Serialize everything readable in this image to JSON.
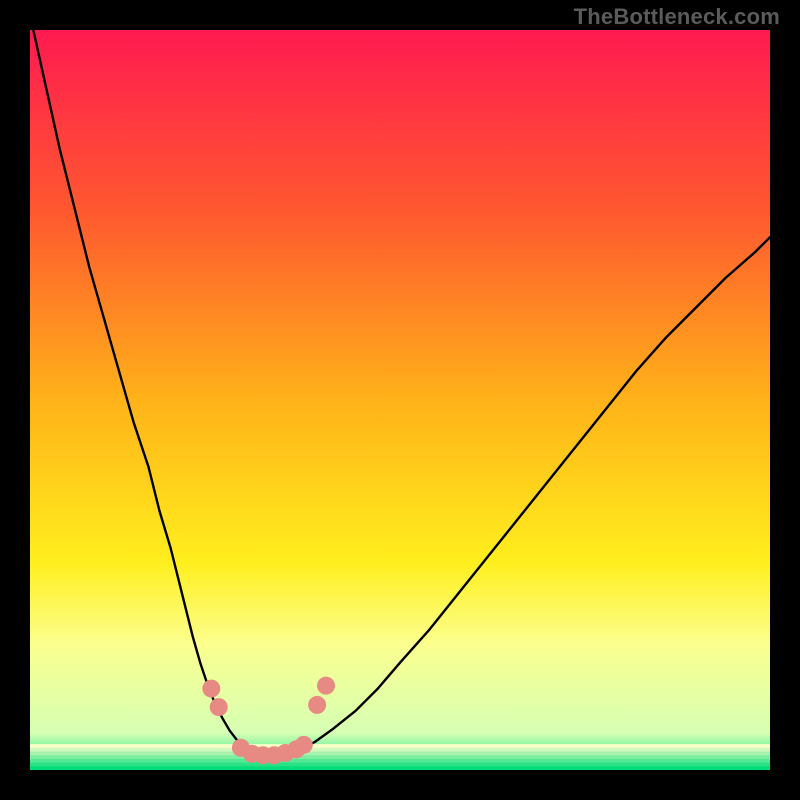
{
  "attribution": {
    "text": "TheBottleneck.com"
  },
  "chart_data": {
    "type": "line",
    "title": "",
    "xlabel": "",
    "ylabel": "",
    "xlim": [
      0,
      100
    ],
    "ylim": [
      0,
      100
    ],
    "background": {
      "type": "vertical-gradient",
      "stops": [
        {
          "offset": 0.0,
          "color": "#ff1a50"
        },
        {
          "offset": 0.25,
          "color": "#ff5a2f"
        },
        {
          "offset": 0.5,
          "color": "#ffb219"
        },
        {
          "offset": 0.72,
          "color": "#ffef1e"
        },
        {
          "offset": 0.83,
          "color": "#fbff8e"
        },
        {
          "offset": 0.95,
          "color": "#d6ffb4"
        },
        {
          "offset": 1.0,
          "color": "#00e884"
        }
      ]
    },
    "series": [
      {
        "name": "bottleneck-curve",
        "color": "#000000",
        "x": [
          0,
          2,
          4,
          6,
          8,
          10,
          12,
          14,
          16,
          17.5,
          19,
          20,
          21,
          22,
          23,
          24,
          25,
          26,
          27,
          28,
          29,
          30,
          31,
          32.5,
          34,
          36,
          38.5,
          41,
          44,
          47,
          50,
          54,
          58,
          62,
          66,
          70,
          74,
          78,
          82,
          86,
          90,
          94,
          98,
          100
        ],
        "y": [
          102,
          93,
          84,
          76,
          68,
          61,
          54,
          47,
          41,
          35,
          30,
          26,
          22,
          18,
          14.5,
          11.5,
          9.0,
          7.0,
          5.3,
          4.0,
          3.0,
          2.4,
          2.0,
          2.0,
          2.1,
          2.6,
          3.8,
          5.6,
          8.0,
          11.0,
          14.5,
          19.0,
          24.0,
          29.0,
          34.0,
          39.0,
          44.0,
          49.0,
          54.0,
          58.5,
          62.5,
          66.5,
          70.0,
          72.0
        ]
      }
    ],
    "markers": {
      "name": "highlight-points",
      "color": "#e78a83",
      "radius_px": 9,
      "points": [
        {
          "x": 24.5,
          "y": 11.0
        },
        {
          "x": 25.5,
          "y": 8.5
        },
        {
          "x": 28.5,
          "y": 3.0
        },
        {
          "x": 30.0,
          "y": 2.2
        },
        {
          "x": 31.5,
          "y": 2.0
        },
        {
          "x": 33.0,
          "y": 2.0
        },
        {
          "x": 34.5,
          "y": 2.3
        },
        {
          "x": 36.0,
          "y": 2.8
        },
        {
          "x": 37.0,
          "y": 3.4
        },
        {
          "x": 38.8,
          "y": 8.8
        },
        {
          "x": 40.0,
          "y": 11.4
        }
      ]
    },
    "green_band": {
      "y_top": 3.5,
      "y_bottom": 0,
      "stripes": 7
    }
  }
}
